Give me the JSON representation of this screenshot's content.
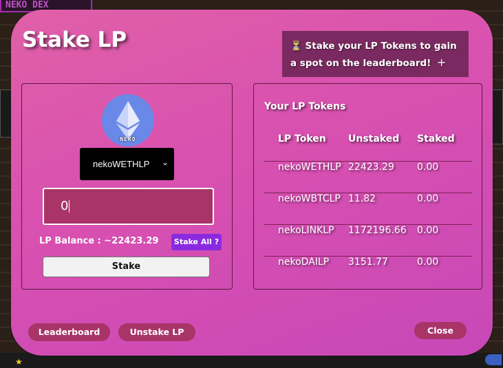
{
  "backdrop": {
    "logo_text": "NEKO DEX"
  },
  "modal": {
    "title": "Stake LP",
    "banner": {
      "hourglass": "⏳",
      "text": "Stake your LP Tokens to gain a spot on the leaderboard!",
      "plus": "+"
    }
  },
  "stake_panel": {
    "logo_icon": "ethereum-icon",
    "logo_label": "NEKO",
    "selected_token": "nekoWETHLP",
    "amount_value": "0",
    "balance_label": "LP Balance : ~22423.29",
    "stake_all_label": "Stake All ?",
    "stake_label": "Stake"
  },
  "tokens_panel": {
    "title": "Your LP Tokens",
    "headers": [
      "LP Token",
      "Unstaked",
      "Staked"
    ],
    "rows": [
      [
        "nekoWETHLP",
        "22423.29",
        "0.00"
      ],
      [
        "nekoWBTCLP",
        "11.82",
        "0.00"
      ],
      [
        "nekoLINKLP",
        "1172196.66",
        "0.00"
      ],
      [
        "nekoDAILP",
        "3151.77",
        "0.00"
      ]
    ]
  },
  "footer": {
    "leaderboard_label": "Leaderboard",
    "unstake_label": "Unstake LP",
    "close_label": "Close"
  }
}
